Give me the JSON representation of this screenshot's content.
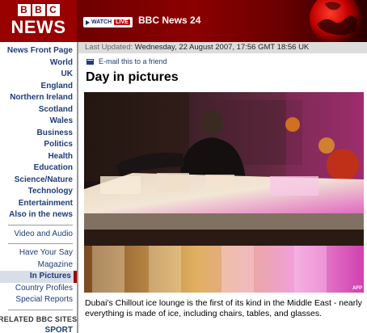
{
  "branding": {
    "bbc_letters": [
      "B",
      "B",
      "C"
    ],
    "news": "NEWS"
  },
  "banner": {
    "watch": "WATCH",
    "live": "LIVE",
    "channel": "BBC News 24"
  },
  "nav": {
    "primary": [
      "News Front Page",
      "World",
      "UK",
      "England",
      "Northern Ireland",
      "Scotland",
      "Wales",
      "Business",
      "Politics",
      "Health",
      "Education",
      "Science/Nature",
      "Technology",
      "Entertainment",
      "Also in the news"
    ],
    "media": "Video and Audio",
    "secondary": [
      "Have Your Say",
      "Magazine"
    ],
    "active": "In Pictures",
    "tertiary": [
      "Country Profiles",
      "Special Reports"
    ],
    "related_title": "RELATED BBC SITES",
    "related": [
      "SPORT"
    ]
  },
  "article": {
    "updated_label": "Last Updated:",
    "updated_value": "Wednesday, 22 August 2007, 17:56 GMT 18:56 UK",
    "email_link": "E-mail this to a friend",
    "headline": "Day in pictures",
    "photo_credit": "AFP",
    "caption": "Dubai's Chillout ice lounge is the first of its kind in the Middle East - nearly everything is made of ice, including chairs, tables, and glasses."
  },
  "colors": {
    "brand_red": "#990000",
    "nav_blue": "#1f3c78"
  }
}
